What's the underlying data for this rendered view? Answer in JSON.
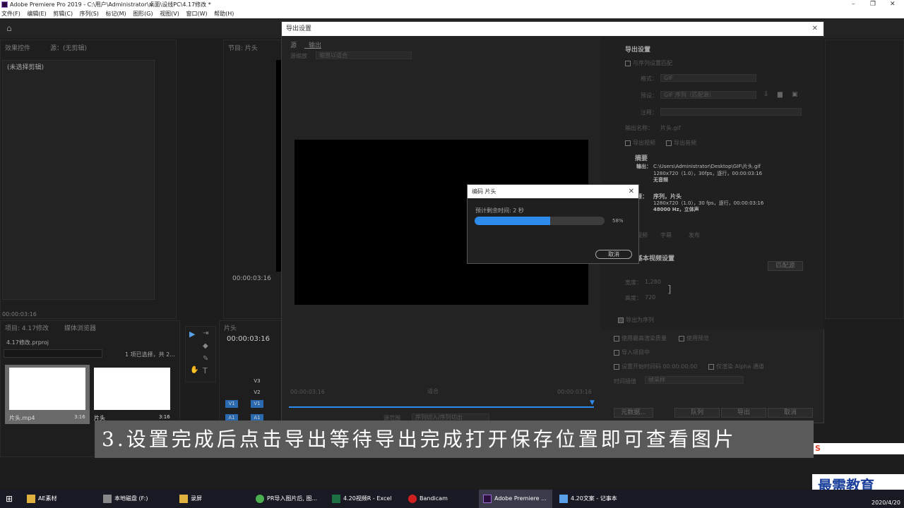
{
  "title_bar": {
    "title": "Adobe Premiere Pro 2019 - C:\\用户\\Administrator\\桌面\\设线PC\\4.17修改 *"
  },
  "menu": [
    "文件(F)",
    "编辑(E)",
    "剪辑(C)",
    "序列(S)",
    "标记(M)",
    "图形(G)",
    "视图(V)",
    "窗口(W)",
    "帮助(H)"
  ],
  "left_panel": {
    "tab1": "效果控件",
    "tab2": "源：(无剪辑)",
    "no_clip": "(未选择剪辑)",
    "timecode": "00:00:03:16"
  },
  "program": {
    "tab": "节目: 片头",
    "timecode": "00:00:03:16"
  },
  "project": {
    "tab1": "项目: 4.17修改",
    "tab2": "媒体浏览器",
    "file": "4.17修改.prproj",
    "selection": "1 项已选择，共 2...",
    "items": [
      {
        "name": "片头.mp4",
        "dur": "3:16"
      },
      {
        "name": "片头",
        "dur": "3:16"
      }
    ]
  },
  "timeline": {
    "tab": "片头",
    "timecode": "00:00:03:16",
    "tracks": [
      "V3",
      "V2",
      "V1",
      "A1"
    ],
    "v1a": "V1",
    "a1a": "A1"
  },
  "export": {
    "title": "导出设置",
    "tabs": [
      "源",
      "输出"
    ],
    "source_scaling_label": "源缩放",
    "source_scaling_value": "缩放以适合",
    "tc_in": "00:00:03:16",
    "tc_out": "00:00:03:16",
    "fit": "适合",
    "source_range_label": "源范围",
    "source_range_value": "序列切入/序列切出",
    "settings_header": "导出设置",
    "match_seq": "与序列设置匹配",
    "format_label": "格式：",
    "format_value": "GIF",
    "preset_label": "预设：",
    "preset_value": "GIF 序列（匹配源）",
    "comments_label": "注释：",
    "output_name_label": "输出名称：",
    "output_name": "片头.gif",
    "export_video": "导出视频",
    "export_audio": "导出音频",
    "summary_header": "摘要",
    "out_label": "输出：",
    "out_path": "C:\\Users\\Administrator\\Desktop\\GIF\\片头.gif",
    "out_line2": "1280x720（1.0），30fps，逐行，00:00:03:16",
    "out_line3": "无音频",
    "src_label": "源：",
    "src_line1": "序列，片头",
    "src_line2": "1280x720（1.0），30 fps，逐行，00:00:03:16",
    "src_line3": "48000 Hz，立体声",
    "lower_tabs": [
      "视频",
      "字幕",
      "发布"
    ],
    "basic_header": "基本视频设置",
    "match_source_btn": "匹配源",
    "width_label": "宽度：",
    "width_value": "1,280",
    "height_label": "高度：",
    "height_value": "720",
    "export_seq": "导出为序列",
    "max_render": "使用最高渲染质量",
    "use_preview": "使用预览",
    "import_project": "导入项目中",
    "set_start_tc": "设置开始时间码",
    "start_tc_value": "00:00:00:00",
    "alpha_only": "仅渲染 Alpha 通道",
    "interp_label": "时间插值",
    "interp_value": "帧采样",
    "btn_metadata": "元数据...",
    "btn_queue": "队列",
    "btn_export": "导出",
    "btn_cancel": "取消"
  },
  "encoding": {
    "title": "编码 片头",
    "remaining": "预计剩余时间: 2 秒",
    "percent": "58%",
    "progress": 0.58,
    "cancel": "取消"
  },
  "caption": "3.设置完成后点击导出等待导出完成打开保存位置即可查看图片",
  "watermark": "最需教育",
  "taskbar": {
    "items": [
      "AE素材",
      "本地磁盘 (F:)",
      "录屏",
      "PR导入图片后, 图...",
      "4.20视频R - Excel",
      "Bandicam",
      "Adobe Premiere ...",
      "4.20文案 - 记事本"
    ],
    "date": "2020/4/20"
  },
  "colors": {
    "accent": "#2d8ceb",
    "caption_bg": "#5a5a5a"
  }
}
